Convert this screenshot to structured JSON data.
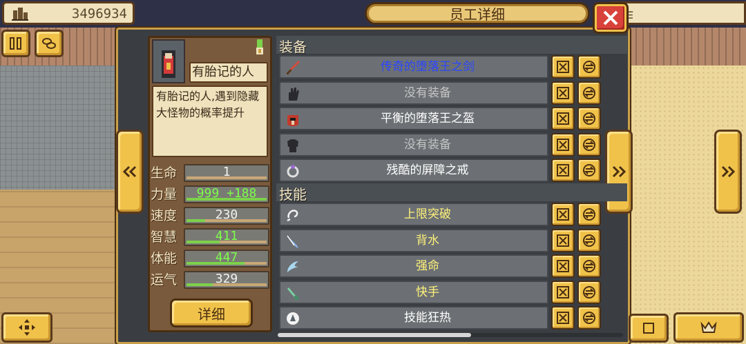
{
  "topbar": {
    "money_value": "3496934",
    "right_text": "作"
  },
  "dialog": {
    "title": "员工详细"
  },
  "character": {
    "name": "有胎记的人",
    "description": "有胎记的人,遇到隐藏大怪物的概率提升",
    "stats": [
      {
        "label": "生命",
        "value": "1",
        "fill": 0.0,
        "color": "#f3f3f3"
      },
      {
        "label": "力量",
        "value": "999 +188",
        "fill": 1.0,
        "color": "#7cff4a"
      },
      {
        "label": "速度",
        "value": "230",
        "fill": 0.23,
        "color": "#f3f3f3"
      },
      {
        "label": "智慧",
        "value": "411",
        "fill": 0.41,
        "color": "#7cff4a"
      },
      {
        "label": "体能",
        "value": "447",
        "fill": 0.72,
        "color": "#7cff4a"
      },
      {
        "label": "运气",
        "value": "329",
        "fill": 0.33,
        "color": "#f3f3f3"
      }
    ],
    "detail_button": "详细"
  },
  "equipment": {
    "label": "装备",
    "items": [
      {
        "name": "传奇的堕落王之剑",
        "color": "#2a46ff",
        "icon": "sword-icon"
      },
      {
        "name": "没有装备",
        "color": "#c4c4c4",
        "icon": "glove-icon"
      },
      {
        "name": "平衡的堕落王之盔",
        "color": "#ffffff",
        "icon": "helmet-icon"
      },
      {
        "name": "没有装备",
        "color": "#c4c4c4",
        "icon": "armor-icon"
      },
      {
        "name": "残酷的屏障之戒",
        "color": "#ffffff",
        "icon": "ring-icon"
      }
    ]
  },
  "skills": {
    "label": "技能",
    "items": [
      {
        "name": "上限突破",
        "color": "#fff27a",
        "icon": "breakthrough-icon"
      },
      {
        "name": "背水",
        "color": "#fff27a",
        "icon": "blade-icon"
      },
      {
        "name": "强命",
        "color": "#fff27a",
        "icon": "wing-icon"
      },
      {
        "name": "快手",
        "color": "#fff27a",
        "icon": "dagger-icon"
      },
      {
        "name": "技能狂热",
        "color": "#ffffff",
        "icon": "fever-icon"
      }
    ]
  }
}
